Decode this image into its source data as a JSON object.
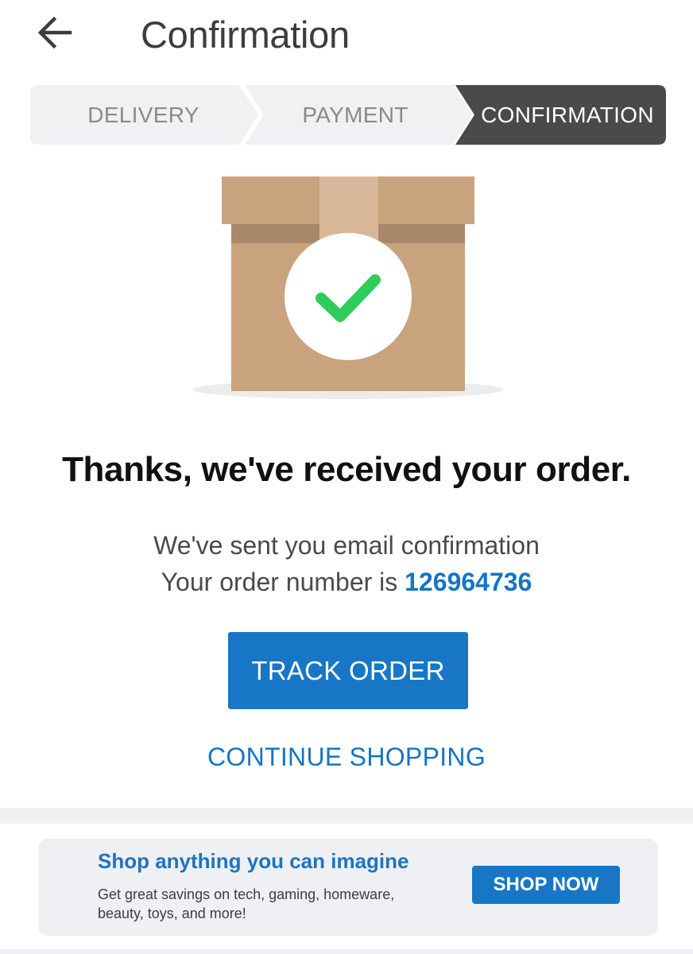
{
  "header": {
    "back_icon": "arrow-left-icon",
    "title": "Confirmation"
  },
  "steps": [
    {
      "label": "DELIVERY",
      "state": "inactive"
    },
    {
      "label": "PAYMENT",
      "state": "inactive"
    },
    {
      "label": "CONFIRMATION",
      "state": "active"
    }
  ],
  "illustration": {
    "icon": "package-check-icon",
    "box_color": "#c9a27e",
    "check_color": "#2ecc5b"
  },
  "main": {
    "heading": "Thanks, we've received your order.",
    "email_message": "We've sent you email confirmation",
    "order_prefix": "Your order number is ",
    "order_number": "126964736",
    "track_order_label": "TRACK ORDER",
    "continue_shopping_label": "CONTINUE SHOPPING"
  },
  "promo": {
    "title": "Shop anything you can imagine",
    "text": "Get great savings on tech, gaming, homeware, beauty, toys, and more!",
    "button_label": "SHOP NOW"
  },
  "colors": {
    "accent": "#1777c6",
    "active_step": "#4a4a4c",
    "inactive_step": "#f0f1f3"
  }
}
